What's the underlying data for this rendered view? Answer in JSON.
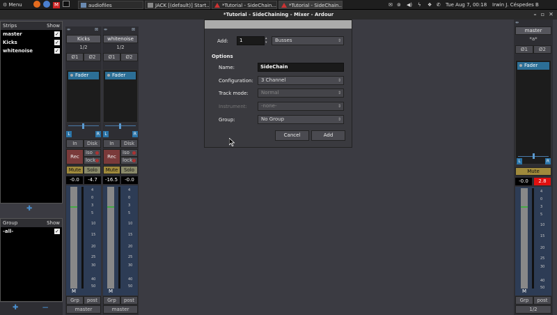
{
  "panel": {
    "menu": "Menu",
    "tasks": [
      "audiofiles",
      "JACK [(default)] Start...",
      "*Tutorial - SideChain...",
      "*Tutorial - SideChain..."
    ],
    "clock": "Tue Aug 7, 00:18",
    "user": "Irwin J. Céspedes B"
  },
  "window": {
    "title": "*Tutorial - SideChaining - Mixer - Ardour"
  },
  "strips_pane": {
    "header": "Strips",
    "show": "Show",
    "items": [
      "master",
      "Kicks",
      "whitenoise"
    ]
  },
  "group_pane": {
    "header": "Group",
    "show": "Show",
    "items": [
      "-all-"
    ]
  },
  "strips": [
    {
      "name": "Kicks",
      "input": "1/2",
      "phase1": "Ø1",
      "phase2": "Ø2",
      "fader": "Fader",
      "in": "In",
      "disk": "Disk",
      "rec": "Rec",
      "iso": "iso",
      "lock": "lock",
      "mute": "Mute",
      "solo": "Solo",
      "gain": "-0.0",
      "peak": "-4.7",
      "meter_label": "M",
      "grp": "Grp",
      "post": "post",
      "output": "master"
    },
    {
      "name": "whitenoise",
      "input": "1/2",
      "phase1": "Ø1",
      "phase2": "Ø2",
      "fader": "Fader",
      "in": "In",
      "disk": "Disk",
      "rec": "Rec",
      "iso": "iso",
      "lock": "lock",
      "mute": "Mute",
      "solo": "Solo",
      "gain": "-16.5",
      "peak": "-0.0",
      "meter_label": "M",
      "grp": "Grp",
      "post": "post",
      "output": "master"
    }
  ],
  "master_strip": {
    "name": "master",
    "comment": "*a*",
    "phase1": "Ø1",
    "phase2": "Ø2",
    "fader": "Fader",
    "mute": "Mute",
    "gain": "-0.0",
    "peak": "2.8",
    "meter_label": "M",
    "grp": "Grp",
    "post": "post",
    "output": "1/2"
  },
  "meter_scale": [
    "4",
    "0",
    "3",
    "5",
    "10",
    "15",
    "20",
    "25",
    "30",
    "40",
    "50"
  ],
  "dialog": {
    "add_label": "Add:",
    "count": "1",
    "type": "Busses",
    "options_header": "Options",
    "name_label": "Name:",
    "name_value": "SideChain",
    "config_label": "Configuration:",
    "config_value": "3 Channel",
    "mode_label": "Track mode:",
    "mode_value": "Normal",
    "instrument_label": "Instrument:",
    "instrument_value": "-none-",
    "group_label": "Group:",
    "group_value": "No Group",
    "cancel": "Cancel",
    "add": "Add"
  }
}
